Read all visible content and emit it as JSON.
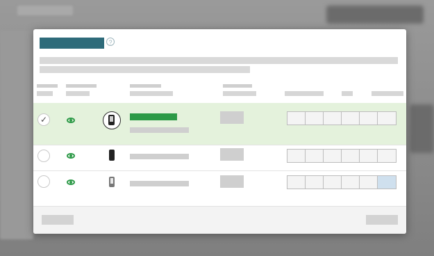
{
  "dialog": {
    "title": "",
    "help_icon": "help-icon",
    "help_glyph": "?"
  },
  "rows": [
    {
      "selected": true,
      "visible_icon": "eye-icon",
      "device_icon": "smartphone-icon",
      "radio_glyph": "✓"
    },
    {
      "selected": false,
      "visible_icon": "eye-icon",
      "device_icon": "phone-icon",
      "radio_glyph": ""
    },
    {
      "selected": false,
      "visible_icon": "eye-icon",
      "device_icon": "feature-phone-icon",
      "radio_glyph": ""
    }
  ],
  "colors": {
    "title_accent": "#2e6b7a",
    "selected_row": "#e4f2dc",
    "name_green": "#2c9a47",
    "eye_green": "#2d9a48",
    "active_cell": "#cfe0ee"
  }
}
